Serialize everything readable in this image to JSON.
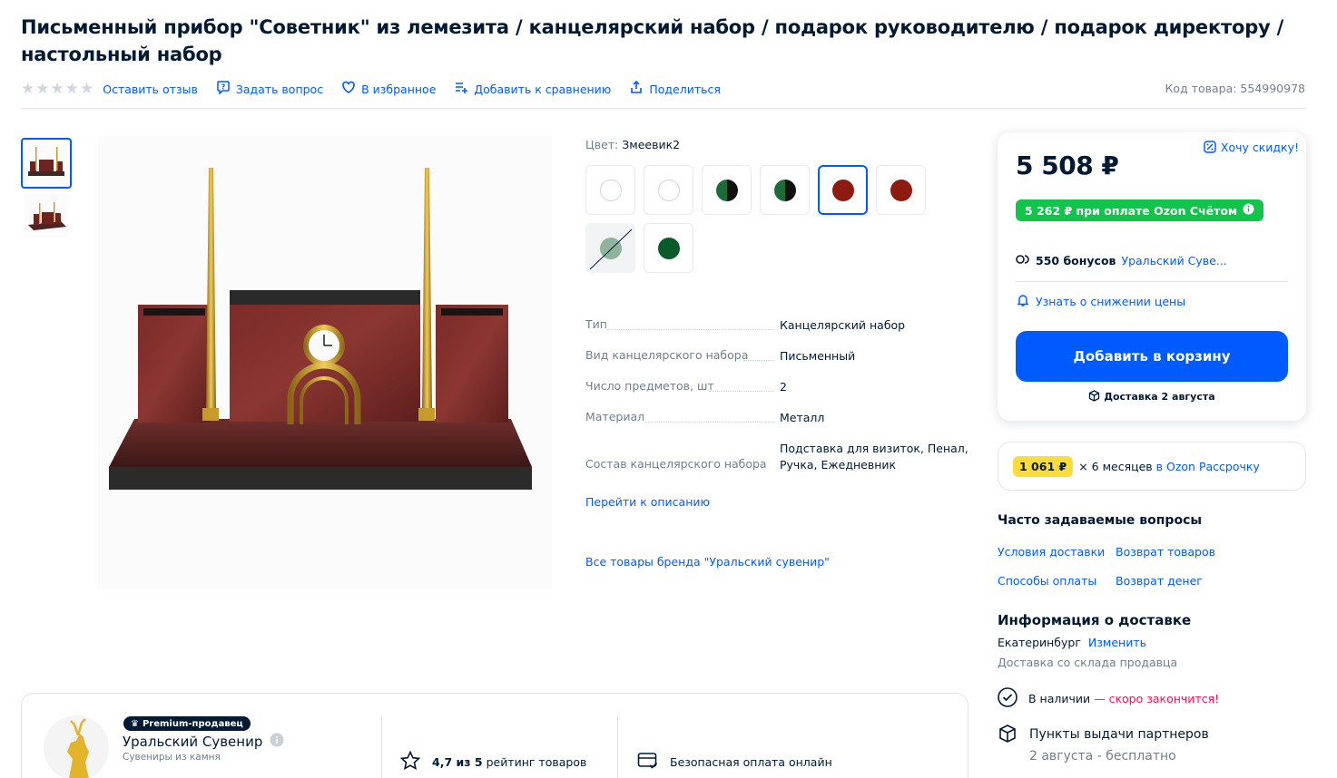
{
  "product": {
    "title": "Письменный прибор \"Советник\" из лемезита / канцелярский набор / подарок руководителю / подарок директору / настольный набор",
    "sku_label": "Код товара: 554990978"
  },
  "actions": {
    "review": "Оставить отзыв",
    "question": "Задать вопрос",
    "favorite": "В избранное",
    "compare": "Добавить к сравнению",
    "share": "Поделиться"
  },
  "colors": {
    "label": "Цвет:",
    "selected": "Змеевик2",
    "swatches": [
      {
        "color": "#ffffff",
        "kind": "plain"
      },
      {
        "color": "#ffffff",
        "kind": "plain"
      },
      {
        "color": "#1e6b3a",
        "kind": "half"
      },
      {
        "color": "#1e6b3a",
        "kind": "half"
      },
      {
        "color": "#8b1c0f",
        "kind": "plain",
        "selected": true
      },
      {
        "color": "#8b1c0f",
        "kind": "plain"
      },
      {
        "color": "#8fb39b",
        "kind": "crossed"
      },
      {
        "color": "#0b5a2a",
        "kind": "plain"
      }
    ]
  },
  "specs": [
    {
      "key": "Тип",
      "value": "Канцелярский набор"
    },
    {
      "key": "Вид канцелярского набора",
      "value": "Письменный"
    },
    {
      "key": "Число предметов, шт",
      "value": "2"
    },
    {
      "key": "Материал",
      "value": "Металл"
    },
    {
      "key": "Состав канцелярского набора",
      "value": "Подставка для визиток, Пенал, Ручка, Ежедневник"
    }
  ],
  "links": {
    "description": "Перейти к описанию",
    "brand": "Все товары бренда \"Уральский сувенир\""
  },
  "buybox": {
    "price": "5 508 ₽",
    "want_discount": "Хочу скидку!",
    "ozon_price": "5 262 ₽ при оплате Ozon Счётом",
    "bonus_count": "550 бонусов",
    "bonus_seller": "Уральский Суве...",
    "notify": "Узнать о снижении цены",
    "add_to_cart": "Добавить в корзину",
    "delivery": "Доставка 2 августа"
  },
  "installment": {
    "price": "1 061 ₽",
    "months": "× 6 месяцев",
    "link": "в Ozon Рассрочку"
  },
  "faq": {
    "title": "Часто задаваемые вопросы",
    "links": [
      "Условия доставки",
      "Возврат товаров",
      "Способы оплаты",
      "Возврат денег"
    ]
  },
  "delivery_info": {
    "title": "Информация о доставке",
    "city": "Екатеринбург",
    "change": "Изменить",
    "warehouse": "Доставка со склада продавца",
    "stock": "В наличии",
    "stock_warning": "— скоро закончится!",
    "pickup_title": "Пункты выдачи партнеров",
    "pickup_detail": "2 августа - бесплатно"
  },
  "seller": {
    "badge": "Premium-продавец",
    "name": "Уральский Сувенир",
    "subtitle": "Сувениры из камня",
    "rating": "4,7 из 5",
    "rating_suffix": "рейтинг товаров",
    "payment": "Безопасная оплата онлайн"
  },
  "theme": {
    "accent": "#005bff",
    "green": "#10c44c",
    "warning": "#f91155"
  }
}
